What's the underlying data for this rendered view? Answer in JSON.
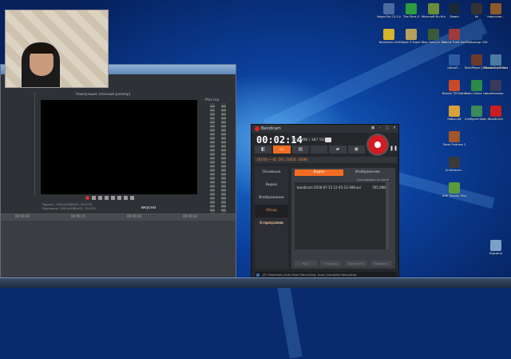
{
  "desktop": {
    "icons": [
      {
        "label": "Vegas Pro 13.0 (64-bit)",
        "color": "#4a6aa0"
      },
      {
        "label": "The Sims 4",
        "color": "#2c9c3c"
      },
      {
        "label": "Minecraft Ru-M.org",
        "color": "#6a8c3a"
      },
      {
        "label": "Steam",
        "color": "#1b2838"
      },
      {
        "label": "kil",
        "color": "#333333"
      },
      {
        "label": "mauncher...",
        "color": "#8a5a2a"
      },
      {
        "label": "Youtubers Life",
        "color": "#d7b52a"
      },
      {
        "label": "Fallout 3 Super Mutant...",
        "color": "#b7a15a"
      },
      {
        "label": "Tom Clancy's Rainbow Six",
        "color": "#3a5a3a"
      },
      {
        "label": "Grand Theft Auto San ...",
        "color": "#a03a3a"
      },
      {
        "label": "Photoshop CS6",
        "color": "#1e4a8a"
      },
      {
        "label": "Ubisoft ...",
        "color": "#2a5aa0"
      },
      {
        "label": "MultiPlayer [0.3a]",
        "color": "#6a3a2a"
      },
      {
        "label": "Grand Theft Auto San ...",
        "color": "#a04a2a"
      },
      {
        "label": "Photoshop Effects Pack",
        "color": "#4a7aa0"
      },
      {
        "label": "Bloons TD Battles",
        "color": "#c94a2a"
      },
      {
        "label": "Kodu Game Lab",
        "color": "#2a8a4a"
      },
      {
        "label": "photoshop",
        "color": "#3a3a5a"
      },
      {
        "label": "Robocraft",
        "color": "#d7a23a"
      },
      {
        "label": "Configure Kodu Ga...",
        "color": "#3a8a5a"
      },
      {
        "label": "Bandicam",
        "color": "#c81e1e"
      },
      {
        "label": "Team Fortress 2",
        "color": "#a0552a"
      },
      {
        "label": "Unfinished...",
        "color": "#3a3a3a"
      },
      {
        "label": "APK Tutorial Tutorial",
        "color": "#5a9a3a"
      },
      {
        "label": "Корзина",
        "color": "#7aa0c8"
      }
    ]
  },
  "editor": {
    "toolbar_text": "Наилучшее (полный размер)",
    "master_label": "Мастер",
    "info_line1": "Проект:  1920x1080x32, 29,970i",
    "info_line2": "Просмотр:  1920x1080x32, 29,970i",
    "ruler": [
      "00:00:00",
      "00:00:15",
      "00:00:29",
      "00:00:44"
    ],
    "watermark": "вкусно"
  },
  "bandicam": {
    "title": "Bandicam",
    "timer": "00:02:14",
    "size": "103.4MB / 387.5GB",
    "target": "[(0,0)] ~ (0, 16), (1920, 1038)",
    "nav": [
      "Основные",
      "Видео",
      "Изображение",
      "Обзор результатов",
      "О программе"
    ],
    "active_nav": "Обзор результатов",
    "tabs": [
      "Видео",
      "Изображение"
    ],
    "sort": "Сортировка по дате",
    "file_name": "bandicam 2016-07-15 12-45-13-308.avi",
    "file_size": "765.0KB",
    "actions": [
      "Play",
      "Открыть",
      "Загрузить",
      "Удалить"
    ],
    "status": "[F1 Blacklink] Auto Start Recording, Auto Complete Recording"
  },
  "colors": {
    "accent": "#f26d21",
    "record": "#d11c22"
  }
}
